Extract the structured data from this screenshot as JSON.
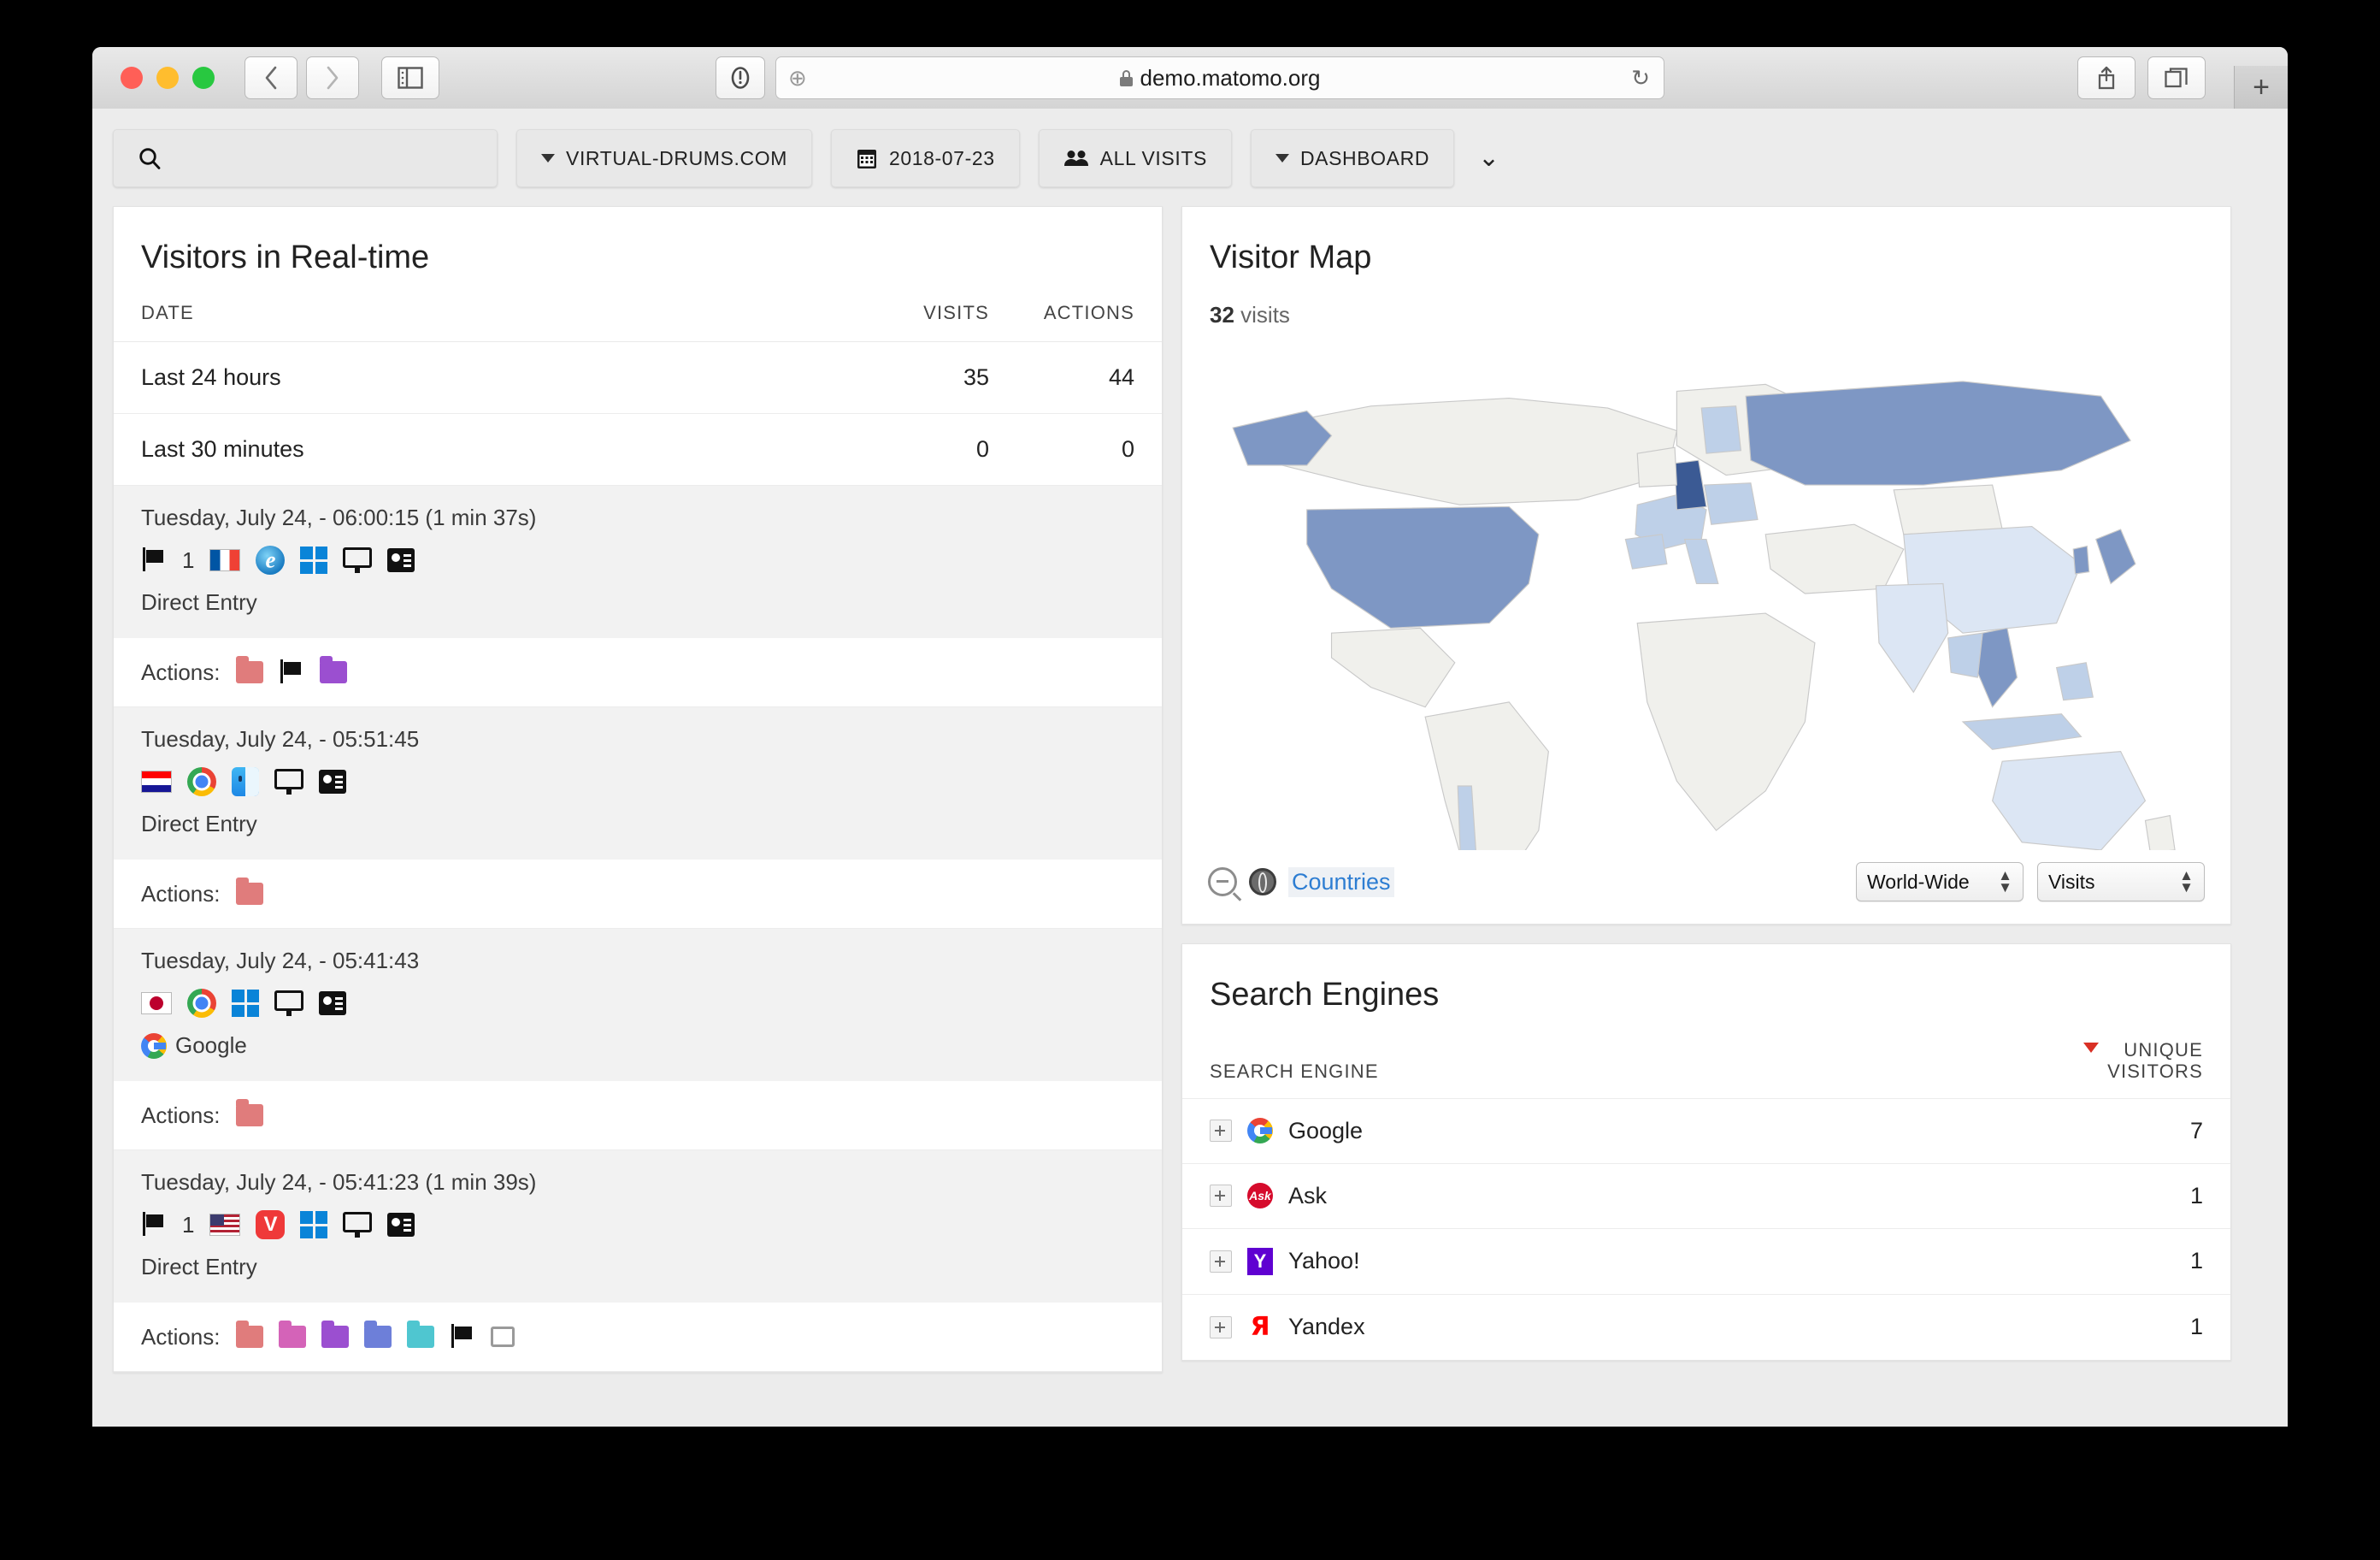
{
  "browser": {
    "url": "demo.matomo.org",
    "lock_icon": "lock-icon",
    "back_icon": "chevron-left-icon",
    "forward_icon": "chevron-right-icon",
    "sidebar_icon": "sidebar-icon",
    "shield_icon": "shield-icon",
    "plus_icon": "plus-circle-icon",
    "reload_icon": "reload-icon",
    "share_icon": "share-icon",
    "tabs_icon": "tab-overview-icon",
    "newtab_label": "+"
  },
  "toolbar": {
    "search_placeholder": "",
    "site_selector": "VIRTUAL-DRUMS.COM",
    "date_selector": "2018-07-23",
    "segment_selector": "ALL VISITS",
    "page_selector": "DASHBOARD",
    "expand_icon": "chevron-double-down-icon"
  },
  "realtime": {
    "title": "Visitors in Real-time",
    "columns": [
      "DATE",
      "VISITS",
      "ACTIONS"
    ],
    "summary_rows": [
      {
        "label": "Last 24 hours",
        "visits": "35",
        "actions": "44"
      },
      {
        "label": "Last 30 minutes",
        "visits": "0",
        "actions": "0"
      }
    ],
    "visits": [
      {
        "time": "Tuesday, July 24, - 06:00:15 (1 min 37s)",
        "pages_count": "1",
        "country": "France",
        "browser": "Internet Explorer",
        "os": "Windows",
        "device": "Desktop",
        "referrer": "Direct Entry",
        "referrer_icon": "",
        "actions_label": "Actions:",
        "actions": [
          "folder-red",
          "flag-mark",
          "folder-purple"
        ]
      },
      {
        "time": "Tuesday, July 24, - 05:51:45",
        "pages_count": "",
        "country": "Croatia",
        "browser": "Chrome",
        "os": "macOS",
        "device": "Desktop",
        "referrer": "Direct Entry",
        "referrer_icon": "",
        "actions_label": "Actions:",
        "actions": [
          "folder-red"
        ]
      },
      {
        "time": "Tuesday, July 24, - 05:41:43",
        "pages_count": "",
        "country": "Japan",
        "browser": "Chrome",
        "os": "Windows",
        "device": "Desktop",
        "referrer": "Google",
        "referrer_icon": "google-icon",
        "actions_label": "Actions:",
        "actions": [
          "folder-red"
        ]
      },
      {
        "time": "Tuesday, July 24, - 05:41:23 (1 min 39s)",
        "pages_count": "1",
        "country": "United States",
        "browser": "Vivaldi",
        "os": "Windows",
        "device": "Desktop",
        "referrer": "Direct Entry",
        "referrer_icon": "",
        "actions_label": "Actions:",
        "actions": [
          "folder-red",
          "folder-pink",
          "folder-purple",
          "folder-indigo",
          "folder-teal",
          "flag-mark",
          "outline"
        ]
      }
    ]
  },
  "visitor_map": {
    "title": "Visitor Map",
    "visits_count": "32",
    "visits_label": "visits",
    "countries_link": "Countries",
    "region_select": "World-Wide",
    "metric_select": "Visits",
    "zoom_out_icon": "zoom-out-icon",
    "globe_icon": "globe-icon",
    "chart_data": {
      "type": "heatmap",
      "title": "Visitor Map",
      "metric": "Visits",
      "scope": "World-Wide",
      "total_visits": 32,
      "colors": {
        "high": "#3b5a94",
        "mid": "#7e97c4",
        "low": "#bed0e8",
        "lightest": "#dce6f4",
        "none": "#f0f0ec"
      },
      "regions": [
        {
          "name": "Germany",
          "level": "high"
        },
        {
          "name": "United States",
          "level": "mid"
        },
        {
          "name": "Russia",
          "level": "mid"
        },
        {
          "name": "Alaska",
          "level": "mid"
        },
        {
          "name": "Vietnam",
          "level": "mid"
        },
        {
          "name": "Japan",
          "level": "mid"
        },
        {
          "name": "France",
          "level": "low"
        },
        {
          "name": "Spain",
          "level": "low"
        },
        {
          "name": "Italy",
          "level": "low"
        },
        {
          "name": "Ukraine",
          "level": "low"
        },
        {
          "name": "Poland",
          "level": "low"
        },
        {
          "name": "Norway",
          "level": "low"
        },
        {
          "name": "China",
          "level": "lightest"
        },
        {
          "name": "India",
          "level": "lightest"
        },
        {
          "name": "Australia",
          "level": "lightest"
        },
        {
          "name": "Indonesia",
          "level": "low"
        },
        {
          "name": "Philippines",
          "level": "low"
        },
        {
          "name": "Chile",
          "level": "low"
        },
        {
          "name": "Croatia",
          "level": "low"
        }
      ]
    }
  },
  "search_engines": {
    "title": "Search Engines",
    "col_name": "SEARCH ENGINE",
    "col_value_line1": "UNIQUE",
    "col_value_line2": "VISITORS",
    "sort_icon": "sort-desc-icon",
    "rows": [
      {
        "name": "Google",
        "icon": "google-icon",
        "value": "7"
      },
      {
        "name": "Ask",
        "icon": "ask-icon",
        "value": "1"
      },
      {
        "name": "Yahoo!",
        "icon": "yahoo-icon",
        "value": "1"
      },
      {
        "name": "Yandex",
        "icon": "yandex-icon",
        "value": "1"
      }
    ]
  }
}
